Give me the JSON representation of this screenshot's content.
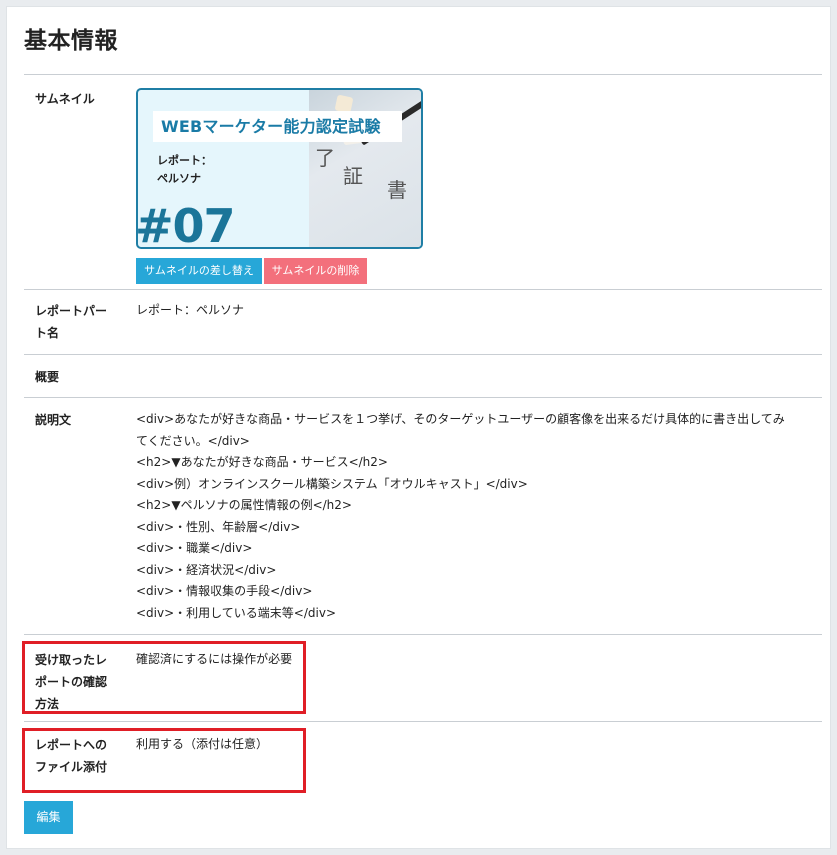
{
  "page": {
    "title": "基本情報"
  },
  "thumbnail": {
    "label": "サムネイル",
    "image": {
      "heading": "WEBマーケター能力認定試験",
      "subtitle_line1": "レポート：",
      "subtitle_line2": "ペルソナ",
      "number": "#07",
      "photo_chars": [
        "了",
        "証",
        "書"
      ]
    },
    "replace_button": "サムネイルの差し替え",
    "delete_button": "サムネイルの削除"
  },
  "report_part": {
    "label_line1": "レポートパー",
    "label_line2": "ト名",
    "value": "レポート：ペルソナ"
  },
  "summary": {
    "label": "概要",
    "value": ""
  },
  "description": {
    "label": "説明文",
    "lines": [
      "<div>あなたが好きな商品・サービスを１つ挙げ、そのターゲットユーザーの顧客像を出来るだけ具体的に書き出してみ",
      "てください。</div>",
      "<h2>▼あなたが好きな商品・サービス</h2>",
      "<div>例）オンラインスクール構築システム「オウルキャスト」</div>",
      "<h2>▼ペルソナの属性情報の例</h2>",
      "<div>・性別、年齢層</div>",
      "<div>・職業</div>",
      "<div>・経済状況</div>",
      "<div>・情報収集の手段</div>",
      "<div>・利用している端末等</div>"
    ]
  },
  "confirmation": {
    "label_line1": "受け取ったレ",
    "label_line2": "ポートの確認",
    "label_line3": "方法",
    "value": "確認済にするには操作が必要"
  },
  "attachment": {
    "label_line1": "レポートへの",
    "label_line2": "ファイル添付",
    "value": "利用する（添付は任意）"
  },
  "edit_button": "編集",
  "colors": {
    "accent": "#27a7d8",
    "danger": "#f3707c",
    "highlight": "#e01e26"
  }
}
